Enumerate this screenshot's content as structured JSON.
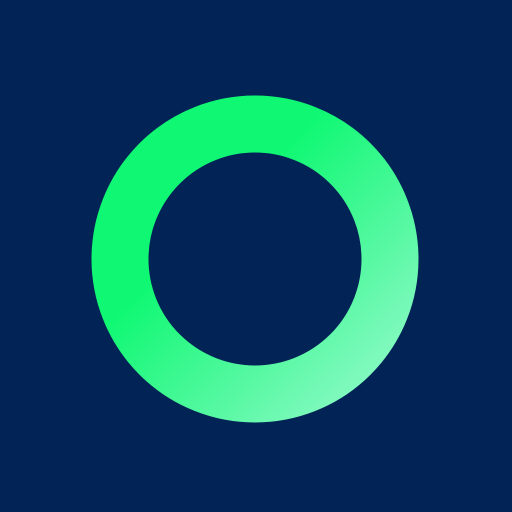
{
  "logo": {
    "name": "ring-logo",
    "background_color": "#022355",
    "ring_gradient": {
      "start_color": "#10F873",
      "end_color": "#8FF9C8"
    }
  }
}
